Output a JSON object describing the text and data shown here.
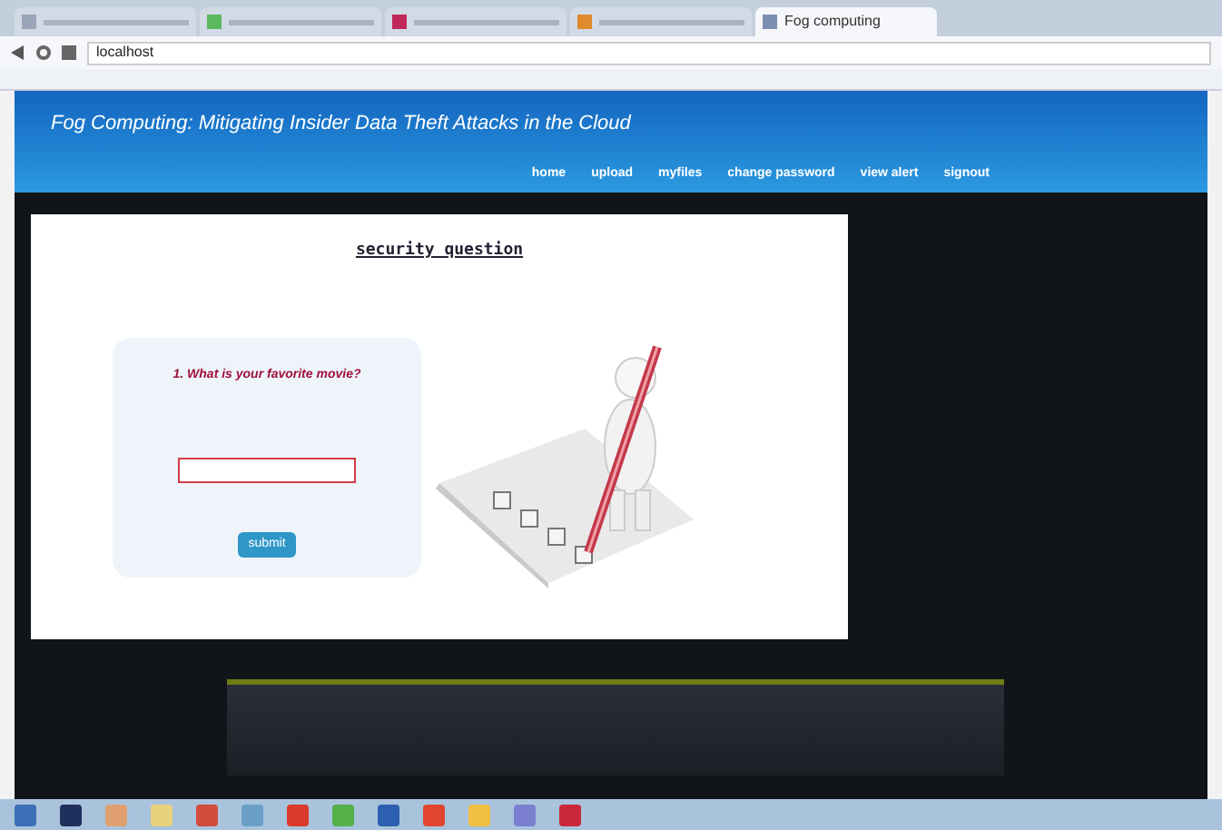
{
  "browser": {
    "tabs": [
      {
        "selected": false,
        "color": "#9aa6b8"
      },
      {
        "selected": false,
        "color": "#5cb85c"
      },
      {
        "selected": false,
        "color": "#c0285a"
      },
      {
        "selected": false,
        "color": "#e08a2c"
      },
      {
        "selected": true,
        "color": "#7d8fb0",
        "title": "Fog computing"
      }
    ],
    "url": "localhost"
  },
  "header": {
    "title": "Fog Computing: Mitigating Insider Data Theft Attacks in the Cloud",
    "nav": [
      {
        "label": "home"
      },
      {
        "label": "upload"
      },
      {
        "label": "myfiles"
      },
      {
        "label": "change password"
      },
      {
        "label": "view alert"
      },
      {
        "label": "signout"
      }
    ]
  },
  "content": {
    "heading": "security question",
    "question": "1. What is your favorite movie?",
    "submit": "submit"
  },
  "taskbar": {
    "apps": [
      {
        "color": "#3b6fb6"
      },
      {
        "color": "#1f2f5e"
      },
      {
        "color": "#e0a070"
      },
      {
        "color": "#e8d27a"
      },
      {
        "color": "#d24b3b"
      },
      {
        "color": "#6aa0c8"
      },
      {
        "color": "#d93a2b"
      },
      {
        "color": "#55b04a"
      },
      {
        "color": "#2d5fb0"
      },
      {
        "color": "#e2452f"
      },
      {
        "color": "#f0c040"
      },
      {
        "color": "#7a7fd0"
      },
      {
        "color": "#c8283a"
      }
    ]
  }
}
